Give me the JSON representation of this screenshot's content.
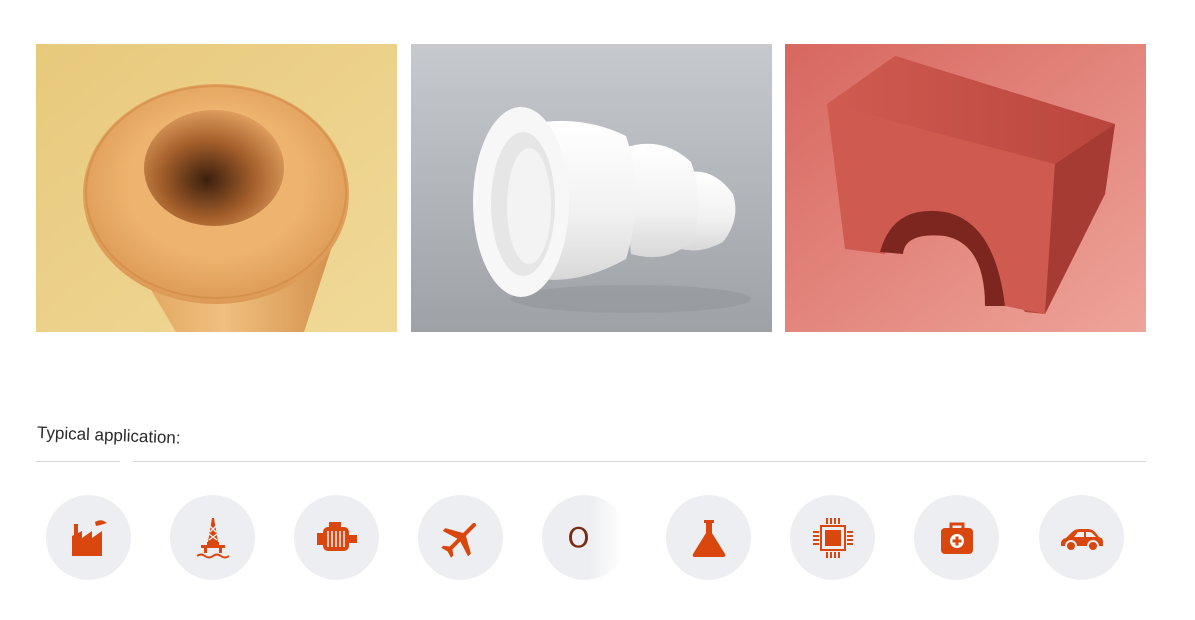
{
  "gallery": [
    {
      "name": "ceramic-tube-image",
      "colors": {
        "bg": "#e9cf86",
        "part": "#e2a35e"
      }
    },
    {
      "name": "white-ceramic-nozzle-image",
      "colors": {
        "bg": "#b9bcc0",
        "part": "#f6f6f6"
      }
    },
    {
      "name": "red-ceramic-block-image",
      "colors": {
        "bg": "#e48c82",
        "part": "#c8564d"
      }
    }
  ],
  "applications": {
    "label": "Typical application:",
    "icon_color": "#d9460e",
    "circle_color": "#eceef1",
    "items": [
      {
        "icon": "factory-icon"
      },
      {
        "icon": "oil-rig-icon"
      },
      {
        "icon": "electric-motor-icon"
      },
      {
        "icon": "airplane-icon"
      },
      {
        "icon": "letter-o-icon",
        "text": "O"
      },
      {
        "icon": "flask-icon"
      },
      {
        "icon": "microchip-icon"
      },
      {
        "icon": "medical-kit-icon"
      },
      {
        "icon": "car-icon"
      }
    ]
  }
}
